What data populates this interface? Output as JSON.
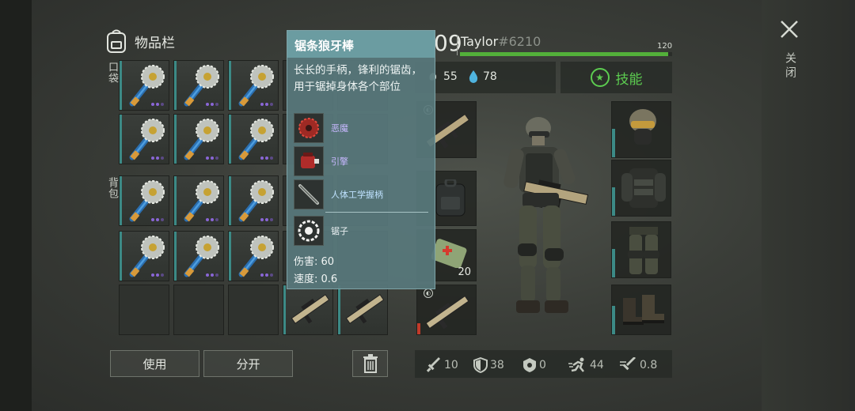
{
  "inventory": {
    "title": "物品栏",
    "pocket_label": "口袋",
    "backpack_label": "背包",
    "use_button": "使用",
    "split_button": "分开"
  },
  "tooltip": {
    "title": "锯条狼牙棒",
    "description": "长长的手柄，锋利的锯齿，用于锯掉身体各个部位",
    "mods": [
      {
        "name": "恶魔",
        "icon": "saw-blade-icon",
        "color": "#c8b8ff"
      },
      {
        "name": "引擎",
        "icon": "engine-icon",
        "color": "#c8b8ff"
      },
      {
        "name": "人体工学握柄",
        "icon": "grip-icon",
        "color": "#bfe2ff"
      },
      {
        "name": "锯子",
        "icon": "circular-saw-icon",
        "color": "#e8eef0"
      }
    ],
    "damage": "伤害: 60",
    "speed": "速度: 0.6"
  },
  "character": {
    "level_digits": "09",
    "name": "Taylor",
    "tag": "#6210",
    "xp_max": "120",
    "xp_fraction": 0.98,
    "food": "55",
    "water": "78",
    "skills_label": "技能",
    "ammo_count": "20"
  },
  "bottom_stats": {
    "attack": "10",
    "defense": "38",
    "armor": "0",
    "speed": "44",
    "attack_speed": "0.8"
  },
  "close_label": "关闭",
  "colors": {
    "accent_teal": "#3c8a86",
    "xp_green": "#53b03a",
    "skill_green": "#5ccc50",
    "rarity_purple": "#8a66d6",
    "tooltip_bg": "#58787c"
  }
}
